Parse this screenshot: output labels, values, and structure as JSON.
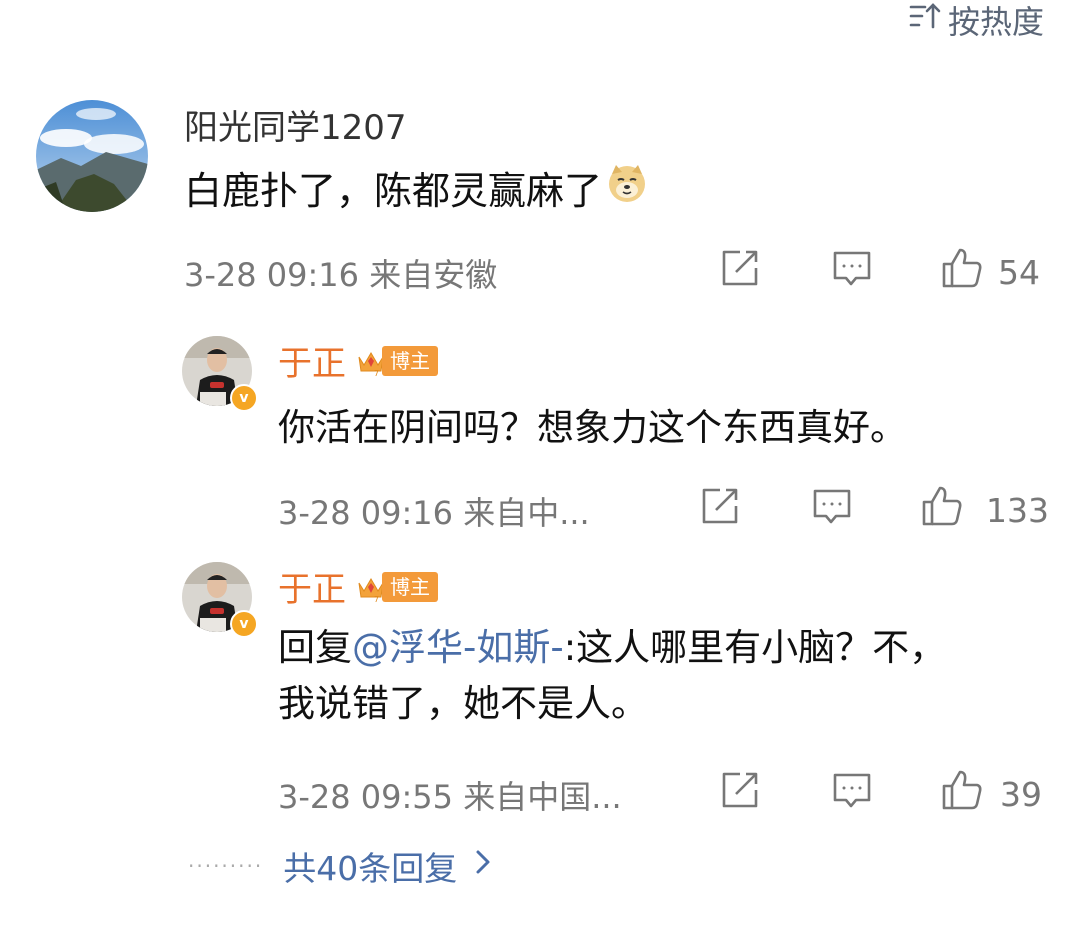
{
  "sort": {
    "label": "按热度",
    "icon": "sort-icon"
  },
  "comment": {
    "user": "阳光同学1207",
    "text": "白鹿扑了，陈都灵赢麻了",
    "emoji": "doge-emoji",
    "meta": "3-28 09:16 来自安徽",
    "like_count": "54"
  },
  "replies": [
    {
      "user": "于正",
      "badge": "博主",
      "text": "你活在阴间吗？想象力这个东西真好。",
      "meta": "3-28 09:16 来自中...",
      "like_count": "133"
    },
    {
      "user": "于正",
      "badge": "博主",
      "prefix": "回复",
      "mention": "@浮华-如斯-",
      "line1_rest": ":这人哪里有小脑？不，",
      "line2": "我说错了，她不是人。",
      "meta": "3-28 09:55 来自中国...",
      "like_count": "39"
    }
  ],
  "more_replies": {
    "dots": "·········",
    "label": "共40条回复",
    "icon": "chevron-right-icon"
  },
  "colors": {
    "accent_orange": "#e8722c",
    "link_blue": "#4a6ea8",
    "badge_orange": "#f39a3a",
    "meta_gray": "#777777"
  }
}
